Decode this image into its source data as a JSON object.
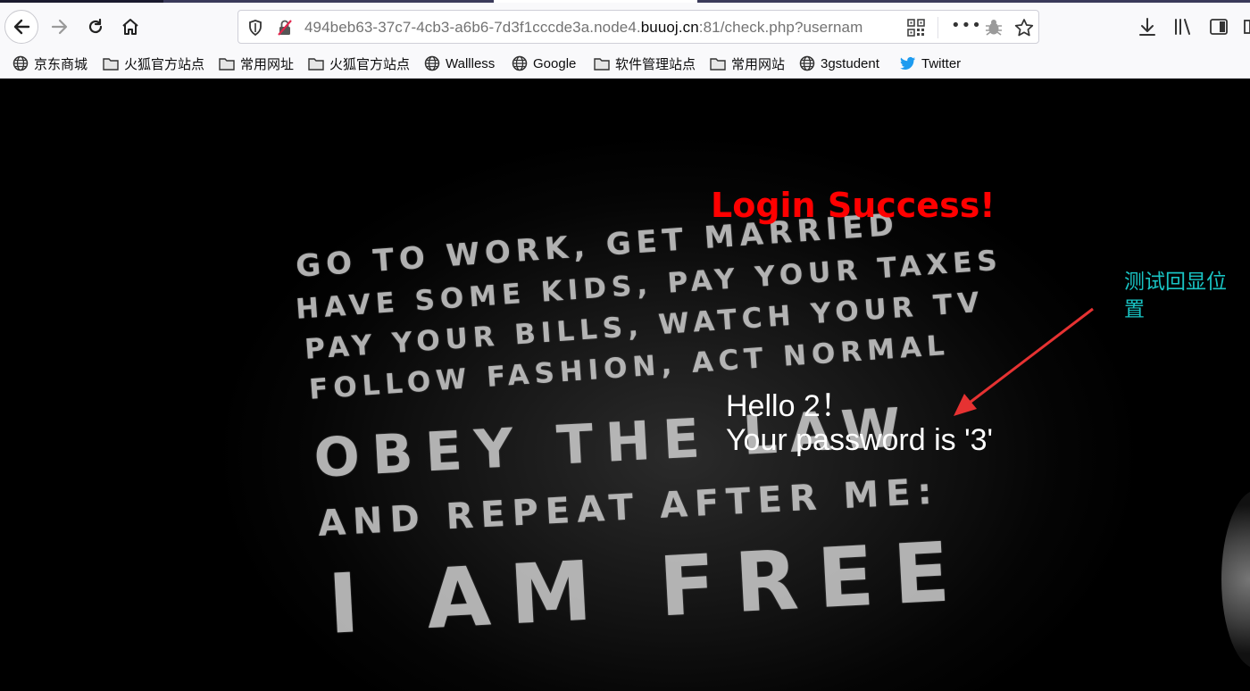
{
  "browser": {
    "url_prefix": "494beb63-37c7-4cb3-a6b6-7d3f1cccde3a.node4.",
    "url_domain": "buuoj.cn",
    "url_suffix": ":81/check.php?usernam",
    "buttons": {
      "back": "back-arrow-icon",
      "forward": "forward-arrow-icon",
      "reload": "reload-icon",
      "home": "home-icon",
      "more": "•••",
      "downloads": "download-icon",
      "library": "library-icon",
      "sidebar": "sidebar-icon"
    }
  },
  "bookmarks": [
    {
      "label": "京东商城",
      "icon": "globe-icon"
    },
    {
      "label": "火狐官方站点",
      "icon": "folder-icon"
    },
    {
      "label": "常用网址",
      "icon": "folder-icon"
    },
    {
      "label": "火狐官方站点",
      "icon": "folder-icon"
    },
    {
      "label": "Wallless",
      "icon": "globe-icon"
    },
    {
      "label": "Google",
      "icon": "globe-icon"
    },
    {
      "label": "软件管理站点",
      "icon": "folder-icon"
    },
    {
      "label": "常用网站",
      "icon": "folder-icon"
    },
    {
      "label": "3gstudent",
      "icon": "globe-icon"
    },
    {
      "label": "Twitter",
      "icon": "twitter-icon"
    }
  ],
  "page": {
    "title": "Login Success!",
    "hello": "Hello 2！",
    "password_line": "Your password is '3'",
    "annotation": "测试回显位置",
    "poster_lines": [
      "GO TO WORK, GET MARRIED",
      "HAVE SOME KIDS, PAY YOUR TAXES",
      "PAY YOUR BILLS, WATCH YOUR TV",
      "FOLLOW FASHION, ACT NORMAL",
      "OBEY THE LAW",
      "AND REPEAT AFTER ME:",
      "I AM FREE"
    ]
  },
  "colors": {
    "title": "#ff0000",
    "annotation": "#19c3c3",
    "arrow": "#e63232",
    "text": "#ffffff"
  }
}
